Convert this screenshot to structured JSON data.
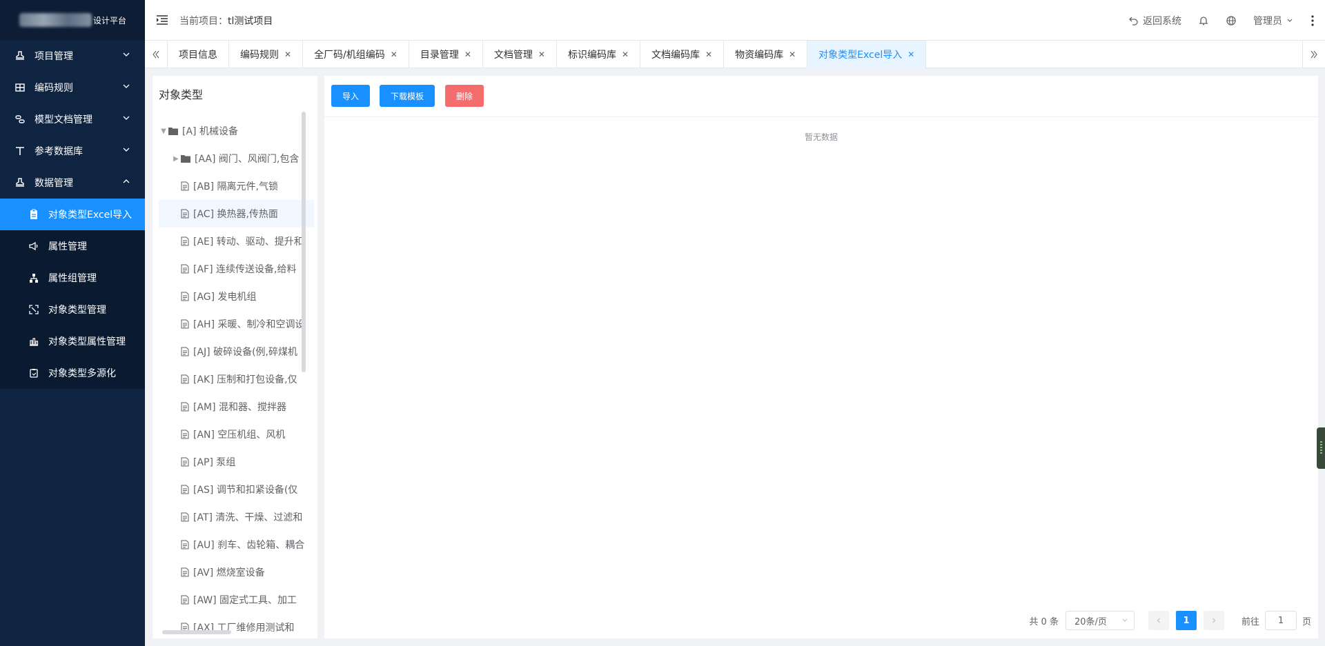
{
  "app": {
    "logo_text": "设计平台"
  },
  "header": {
    "project_label": "当前项目：",
    "project_name": "tl测试项目",
    "back_label": "返回系统",
    "user_label": "管理员"
  },
  "sidebar": {
    "menus": [
      {
        "label": "项目管理",
        "icon": "stamp-icon"
      },
      {
        "label": "编码规则",
        "icon": "grid-icon"
      },
      {
        "label": "模型文档管理",
        "icon": "link-icon"
      },
      {
        "label": "参考数据库",
        "icon": "text-icon"
      },
      {
        "label": "数据管理",
        "icon": "stamp-icon"
      }
    ],
    "sub_items": [
      {
        "label": "对象类型Excel导入",
        "icon": "clipboard-icon"
      },
      {
        "label": "属性管理",
        "icon": "speaker-icon"
      },
      {
        "label": "属性组管理",
        "icon": "tree-icon"
      },
      {
        "label": "对象类型管理",
        "icon": "expand-icon"
      },
      {
        "label": "对象类型属性管理",
        "icon": "bar-chart-icon"
      },
      {
        "label": "对象类型多源化",
        "icon": "copy-icon"
      }
    ]
  },
  "tabs": [
    {
      "label": "项目信息",
      "closable": false
    },
    {
      "label": "编码规则",
      "closable": true
    },
    {
      "label": "全厂码/机组编码",
      "closable": true
    },
    {
      "label": "目录管理",
      "closable": true
    },
    {
      "label": "文档管理",
      "closable": true
    },
    {
      "label": "标识编码库",
      "closable": true
    },
    {
      "label": "文档编码库",
      "closable": true
    },
    {
      "label": "物资编码库",
      "closable": true
    },
    {
      "label": "对象类型Excel导入",
      "closable": true
    }
  ],
  "tree": {
    "title": "对象类型",
    "root": "[A] 机械设备",
    "nodes": [
      "[AA] 阀门、风阀门,包含",
      "[AB] 隔离元件,气锁",
      "[AC] 换热器,传热面",
      "[AE] 转动、驱动、提升和",
      "[AF] 连续传送设备,给料",
      "[AG] 发电机组",
      "[AH] 采暖、制冷和空调设",
      "[AJ] 破碎设备(例,碎煤机",
      "[AK] 压制和打包设备,仅",
      "[AM] 混和器、搅拌器",
      "[AN] 空压机组、风机",
      "[AP] 泵组",
      "[AS] 调节和扣紧设备(仅",
      "[AT] 清洗、干燥、过滤和",
      "[AU] 刹车、齿轮箱、耦合",
      "[AV] 燃烧室设备",
      "[AW] 固定式工具、加工",
      "[AX] 工厂维修用测试和"
    ]
  },
  "toolbar": {
    "import_label": "导入",
    "download_label": "下载模板",
    "delete_label": "删除"
  },
  "table": {
    "empty_text": "暂无数据"
  },
  "pagination": {
    "total_text": "共 0 条",
    "page_size": "20条/页",
    "current_page": "1",
    "goto_label": "前往",
    "goto_value": "1",
    "page_suffix": "页"
  },
  "colors": {
    "primary": "#1890ff",
    "danger": "#f56c6c",
    "sidebar_bg": "#0f2440"
  }
}
